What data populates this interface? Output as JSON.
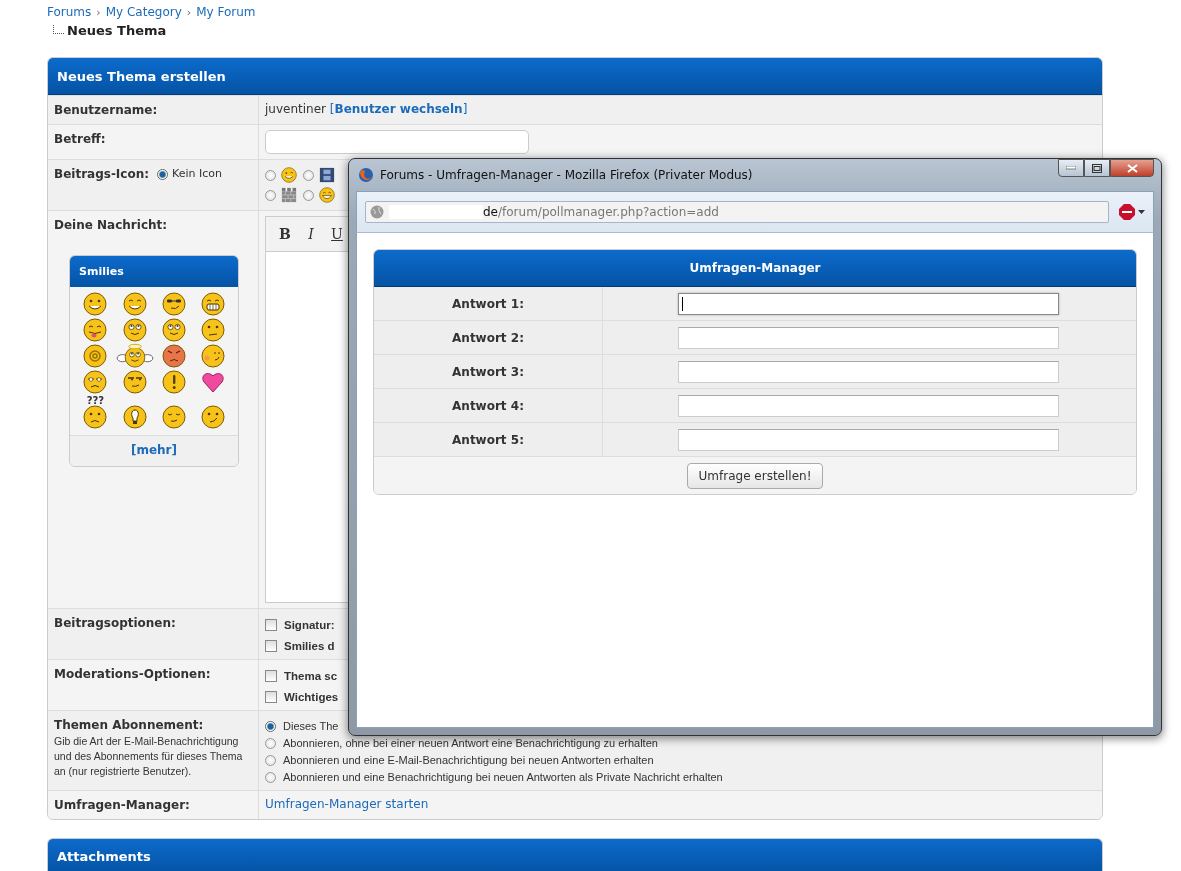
{
  "breadcrumb": {
    "links": [
      "Forums",
      "My Category",
      "My Forum"
    ],
    "separator": "›",
    "current": "Neues Thema"
  },
  "form": {
    "title": "Neues Thema erstellen",
    "rows": [
      {
        "kind": "username",
        "label": "Benutzername:",
        "value": "juventiner",
        "link": {
          "open": "[",
          "label": "Benutzer wechseln",
          "close": "]"
        }
      },
      {
        "kind": "text_input",
        "label": "Betreff:"
      },
      {
        "kind": "post_icon",
        "label": "Beitrags-Icon:",
        "default": {
          "label": "Kein Icon",
          "selected": true
        },
        "icons": [
          {
            "kind": "wink",
            "selected": false
          },
          {
            "kind": "film",
            "selected": false
          },
          {
            "kind": "bricks",
            "selected": false
          },
          {
            "kind": "grin",
            "selected": false
          }
        ]
      },
      {
        "kind": "message",
        "label": "Deine Nachricht:",
        "toolbar": [
          "B",
          "I",
          "U"
        ],
        "smilies": {
          "title": "Smilies",
          "items": [
            {
              "kind": "smile"
            },
            {
              "kind": "happy"
            },
            {
              "kind": "cool"
            },
            {
              "kind": "teeth"
            },
            {
              "kind": "tongue"
            },
            {
              "kind": "rolleyes"
            },
            {
              "kind": "rolleyes"
            },
            {
              "kind": "confused"
            },
            {
              "kind": "at"
            },
            {
              "kind": "angel"
            },
            {
              "kind": "angry"
            },
            {
              "kind": "blush"
            },
            {
              "kind": "squint"
            },
            {
              "kind": "smug"
            },
            {
              "kind": "exclaim"
            },
            {
              "kind": "heart"
            },
            {
              "kind": "sad",
              "caption": "???"
            },
            {
              "kind": "idea"
            },
            {
              "kind": "sleepy"
            },
            {
              "kind": "unsure"
            }
          ],
          "more": {
            "open": "[",
            "label": "mehr",
            "close": "]"
          }
        }
      },
      {
        "kind": "checkboxes",
        "label": "Beitragsoptionen:",
        "options": [
          {
            "label": "Signatur:",
            "checked": false
          },
          {
            "label": "Smilies d",
            "checked": false
          }
        ]
      },
      {
        "kind": "checkboxes",
        "label": "Moderations-Optionen:",
        "options": [
          {
            "label": "Thema sc",
            "checked": false
          },
          {
            "label": "Wichtiges",
            "checked": false
          }
        ]
      },
      {
        "kind": "radios",
        "label": "Themen Abonnement:",
        "description": "Gib die Art der E-Mail-Benachrichtigung und des Abonnements für dieses Thema an (nur registrierte Benutzer).",
        "options": [
          {
            "label": "Dieses The",
            "selected": true
          },
          {
            "label": "Abonnieren, ohne bei einer neuen Antwort eine Benachrichtigung zu erhalten",
            "selected": false
          },
          {
            "label": "Abonnieren und eine E-Mail-Benachrichtigung bei neuen Antworten erhalten",
            "selected": false
          },
          {
            "label": "Abonnieren und eine Benachrichtigung bei neuen Antworten als Private Nachricht erhalten",
            "selected": false
          }
        ]
      },
      {
        "kind": "link",
        "label": "Umfragen-Manager:",
        "link": "Umfragen-Manager starten"
      }
    ]
  },
  "attachments": {
    "title": "Attachments"
  },
  "popup": {
    "title": "Forums - Umfragen-Manager - Mozilla Firefox (Privater Modus)",
    "address": {
      "host": "de",
      "path": "/forum/pollmanager.php?action=add"
    },
    "panel": {
      "title": "Umfragen-Manager",
      "answers": [
        {
          "label": "Antwort 1:",
          "focused": true
        },
        {
          "label": "Antwort 2:",
          "focused": false
        },
        {
          "label": "Antwort 3:",
          "focused": false
        },
        {
          "label": "Antwort 4:",
          "focused": false
        },
        {
          "label": "Antwort 5:",
          "focused": false
        }
      ],
      "submit": "Umfrage erstellen!"
    }
  }
}
